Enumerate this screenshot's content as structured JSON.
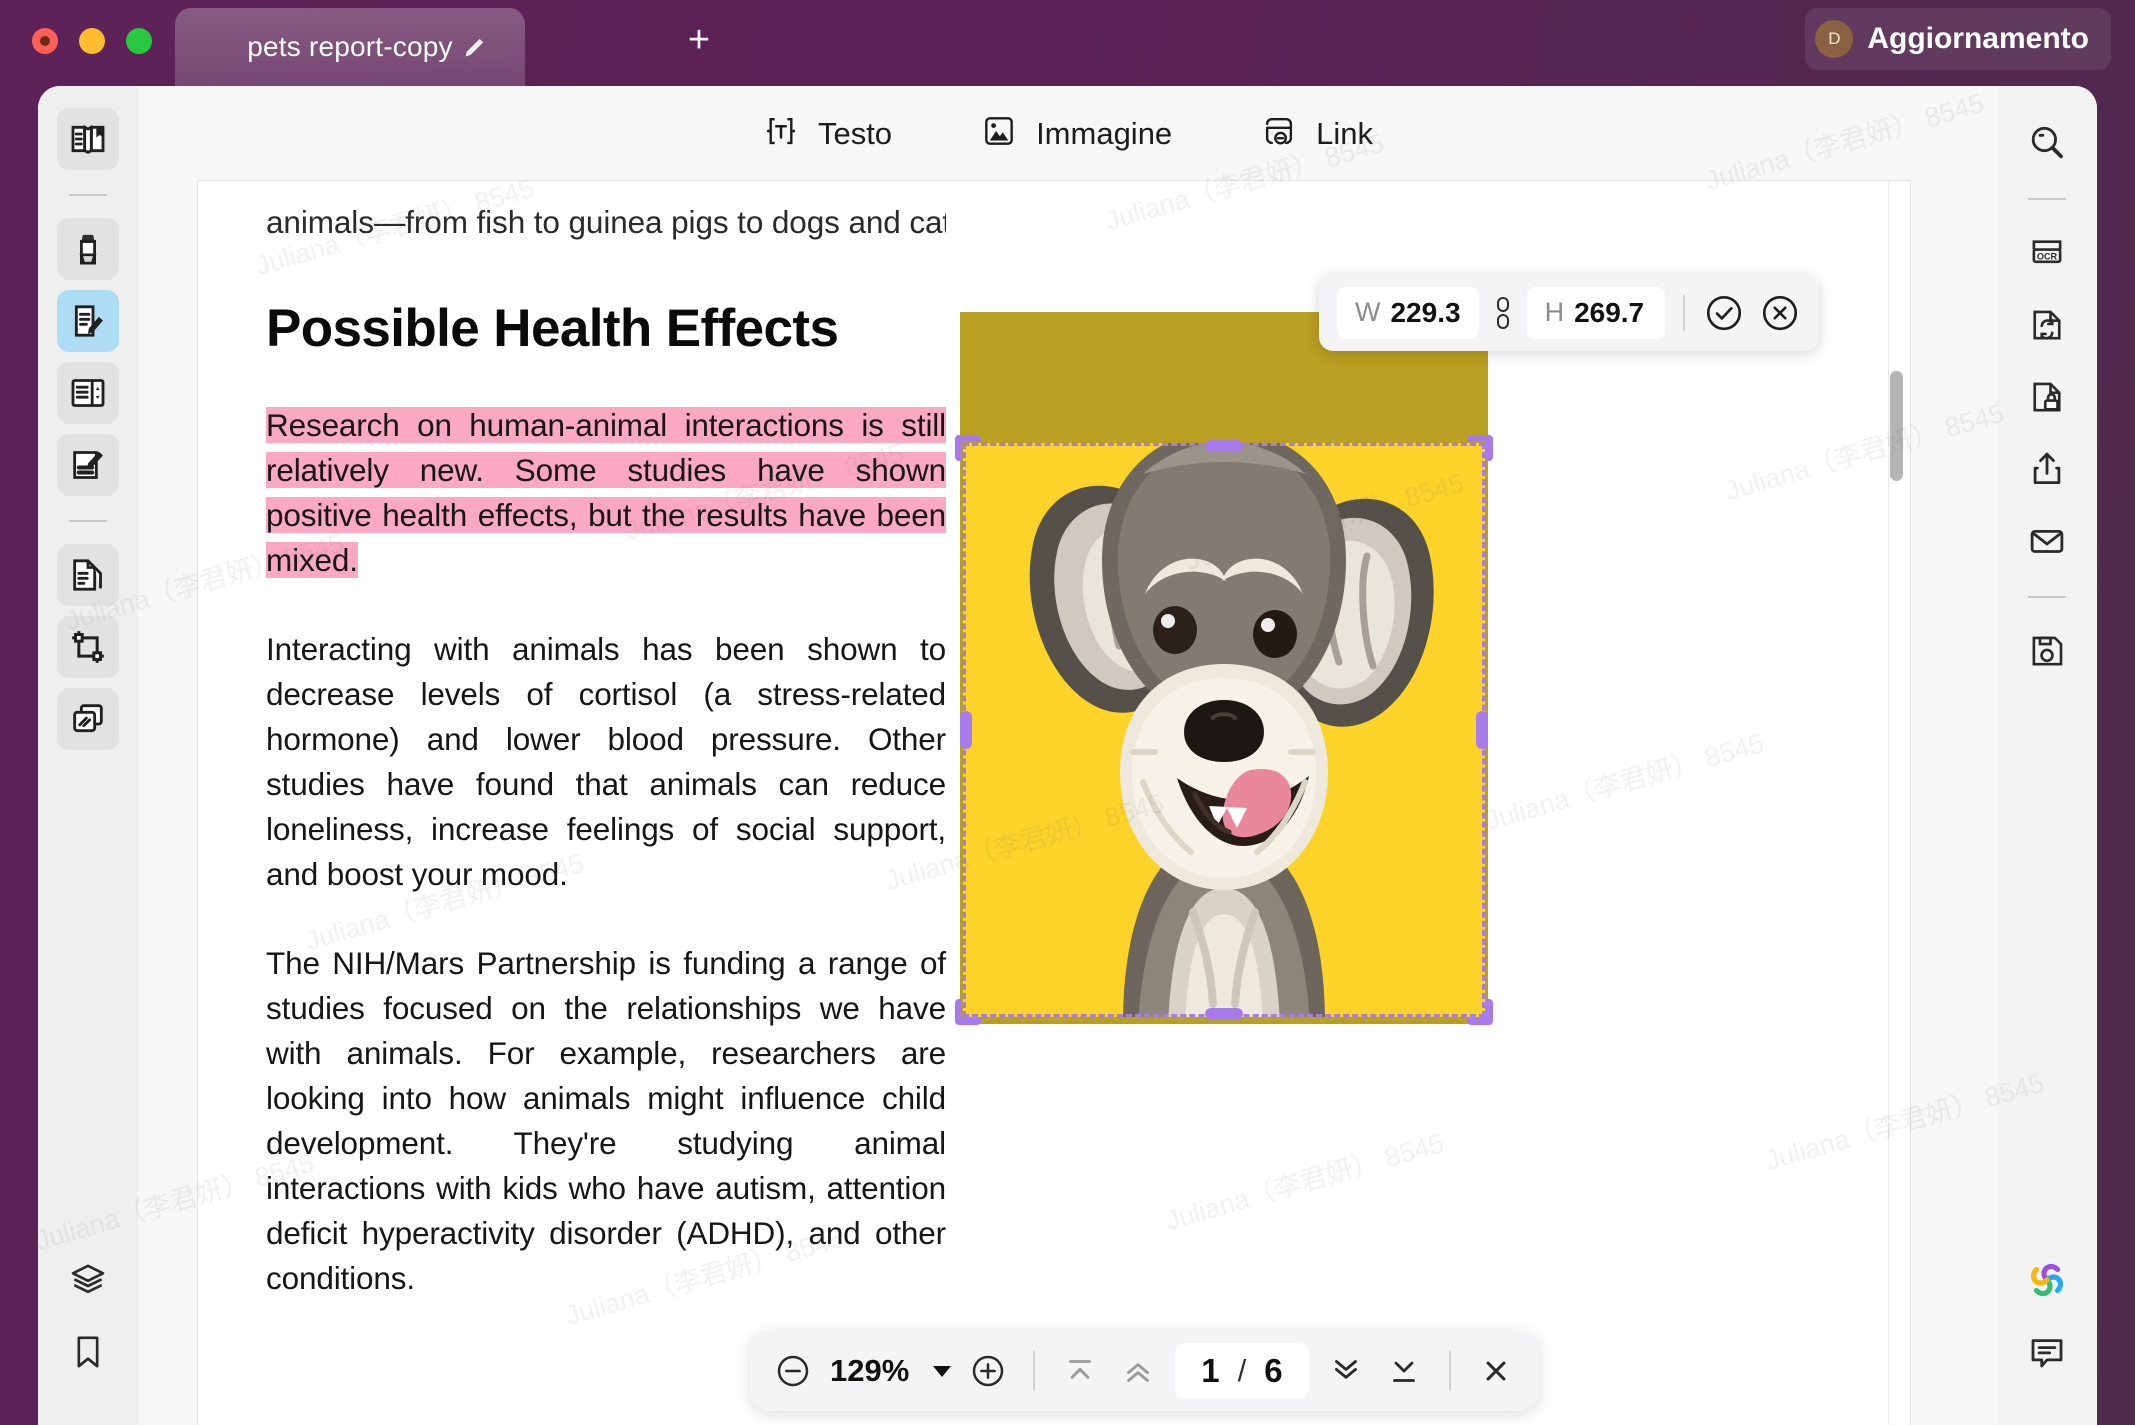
{
  "window": {
    "tab_title": "pets report-copy",
    "new_tab_label": "+",
    "update_label": "Aggiornamento",
    "update_avatar_initial": "D",
    "colors": {
      "window_bg": "#5b2156",
      "tab_bg": "#8e5c8a",
      "accent_active": "#aedcf5",
      "selection_purple": "#a77bea",
      "highlight_pink": "#fba8c3",
      "photo_yellow": "#fcd329",
      "photo_yellow_dim": "#b99f22"
    }
  },
  "doc_toolbar": {
    "items": [
      {
        "label": "Testo",
        "icon": "text-box-icon"
      },
      {
        "label": "Immagine",
        "icon": "image-icon"
      },
      {
        "label": "Link",
        "icon": "link-icon"
      }
    ]
  },
  "left_rail": {
    "items": [
      {
        "name": "reader-view-tool",
        "icon": "book-open-icon",
        "boxed": true,
        "active": false
      },
      {
        "name": "highlighter-tool",
        "icon": "highlighter-icon",
        "boxed": true,
        "active": false
      },
      {
        "name": "edit-content-tool",
        "icon": "document-pen-icon",
        "boxed": true,
        "active": true
      },
      {
        "name": "page-layout-tool",
        "icon": "split-page-icon",
        "boxed": true,
        "active": false
      },
      {
        "name": "fill-sign-tool",
        "icon": "form-pen-icon",
        "boxed": true,
        "active": false
      },
      {
        "name": "organize-pages-tool",
        "icon": "page-copy-icon",
        "boxed": true,
        "active": false
      },
      {
        "name": "crop-tool",
        "icon": "crop-icon",
        "boxed": true,
        "active": false
      },
      {
        "name": "background-tool",
        "icon": "layers-card-icon",
        "boxed": true,
        "active": false
      },
      {
        "name": "layers-tool",
        "icon": "layers-icon",
        "boxed": false,
        "active": false
      },
      {
        "name": "bookmark-tool",
        "icon": "bookmark-icon",
        "boxed": false,
        "active": false
      }
    ]
  },
  "right_rail": {
    "items": [
      {
        "name": "search-tool",
        "icon": "search-icon"
      },
      {
        "name": "ocr-tool",
        "icon": "ocr-icon"
      },
      {
        "name": "convert-tool",
        "icon": "convert-file-icon"
      },
      {
        "name": "protect-tool",
        "icon": "lock-file-icon"
      },
      {
        "name": "share-tool",
        "icon": "share-icon"
      },
      {
        "name": "email-tool",
        "icon": "envelope-icon"
      },
      {
        "name": "save-tool",
        "icon": "save-disk-icon"
      },
      {
        "name": "ai-assistant-tool",
        "icon": "ai-flower-icon"
      },
      {
        "name": "comments-tool",
        "icon": "comment-bubble-icon"
      }
    ]
  },
  "size_popup": {
    "width_key": "W",
    "width_value": "229.3",
    "height_key": "H",
    "height_value": "269.7",
    "lock_icon": "chain-link-icon",
    "confirm_icon": "check-circle-icon",
    "cancel_icon": "close-circle-icon"
  },
  "zoom_bar": {
    "zoom_out_icon": "minus-circle-icon",
    "zoom_level": "129%",
    "zoom_in_icon": "plus-circle-icon",
    "first_page_icon": "first-page-icon",
    "prev_page_icon": "prev-page-icon",
    "current_page": "1",
    "page_separator": "/",
    "total_pages": "6",
    "next_page_icon": "next-page-icon",
    "last_page_icon": "last-page-icon",
    "close_icon": "close-icon"
  },
  "document": {
    "cut_line": "animals—from fish to guinea pigs to dogs and cats.",
    "heading": "Possible Health Effects",
    "paragraph_highlighted": "Research on human-animal interactions is still relatively new. Some studies have shown positive health effects, but the results have been mixed.",
    "paragraph_2": "Interacting with animals has been shown to decrease levels of cortisol (a stress-related hormone) and lower blood pressure. Other studies have found that animals can reduce loneliness, increase feelings of social support, and boost your mood.",
    "paragraph_3": "The NIH/Mars Partnership is funding a range of studies focused on the relationships we have with animals. For example, researchers are looking into how animals might influence child development. They're studying animal interactions with kids who have autism, attention deficit hyperactivity disorder (ADHD), and other conditions.",
    "image_alt": "schnauzer-dog-on-yellow-background",
    "watermark_text": "Juliana（李君妍） 8545"
  }
}
